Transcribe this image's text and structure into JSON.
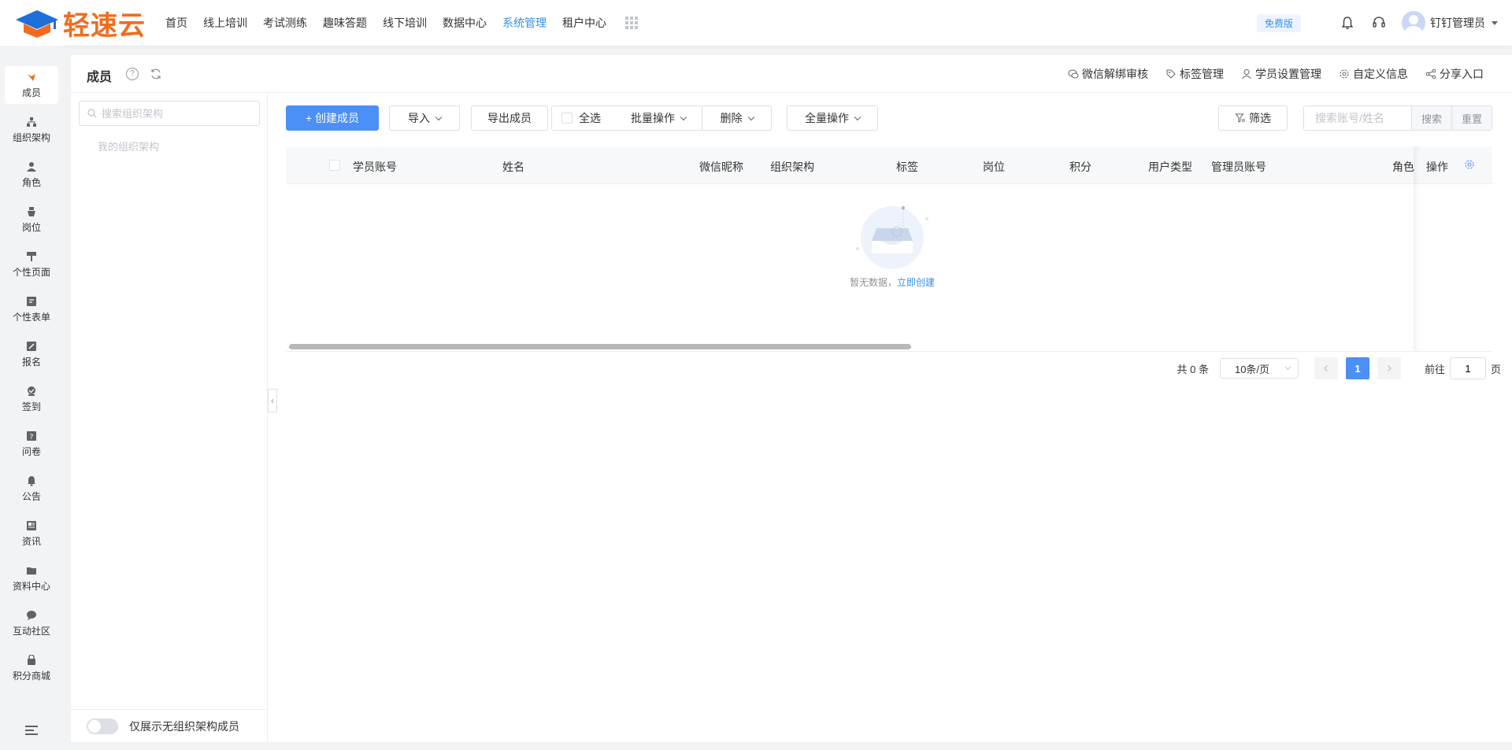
{
  "brand": {
    "name": "轻速云",
    "color": "#f26b1d"
  },
  "colors": {
    "primary": "#4b8ff7",
    "active_nav": "#3a8ee6"
  },
  "topnav": {
    "items": [
      {
        "label": "首页",
        "active": false
      },
      {
        "label": "线上培训",
        "active": false
      },
      {
        "label": "考试测练",
        "active": false
      },
      {
        "label": "趣味答题",
        "active": false
      },
      {
        "label": "线下培训",
        "active": false
      },
      {
        "label": "数据中心",
        "active": false
      },
      {
        "label": "系统管理",
        "active": true
      },
      {
        "label": "租户中心",
        "active": false
      }
    ],
    "apps_icon": "grid-icon"
  },
  "topbar_right": {
    "plan_badge": "免费版",
    "bell_icon": "bell-icon",
    "support_icon": "headset-icon",
    "user_name": "钉钉管理员"
  },
  "sidebar": {
    "items": [
      {
        "label": "成员",
        "icon": "member-icon",
        "active": true
      },
      {
        "label": "组织架构",
        "icon": "org-icon",
        "active": false
      },
      {
        "label": "角色",
        "icon": "role-icon",
        "active": false
      },
      {
        "label": "岗位",
        "icon": "post-icon",
        "active": false
      },
      {
        "label": "个性页面",
        "icon": "brush-icon",
        "active": false
      },
      {
        "label": "个性表单",
        "icon": "form-icon",
        "active": false
      },
      {
        "label": "报名",
        "icon": "signup-icon",
        "active": false
      },
      {
        "label": "签到",
        "icon": "checkin-icon",
        "active": false
      },
      {
        "label": "问卷",
        "icon": "survey-icon",
        "active": false
      },
      {
        "label": "公告",
        "icon": "notice-icon",
        "active": false
      },
      {
        "label": "资讯",
        "icon": "news-icon",
        "active": false
      },
      {
        "label": "资料中心",
        "icon": "folder-icon",
        "active": false
      },
      {
        "label": "互动社区",
        "icon": "chat-icon",
        "active": false
      },
      {
        "label": "积分商城",
        "icon": "shop-icon",
        "active": false
      }
    ]
  },
  "header": {
    "title": "成员",
    "help": "?",
    "links": [
      {
        "label": "微信解绑审核",
        "icon": "wechat-icon"
      },
      {
        "label": "标签管理",
        "icon": "tag-icon"
      },
      {
        "label": "学员设置管理",
        "icon": "user-icon"
      },
      {
        "label": "自定义信息",
        "icon": "gear-icon"
      },
      {
        "label": "分享入口",
        "icon": "share-icon"
      }
    ]
  },
  "org_panel": {
    "search_placeholder": "搜索组织架构",
    "empty_text": "我的组织架构",
    "footer_toggle_label": "仅展示无组织架构成员",
    "toggle_on": false
  },
  "toolbar": {
    "create": "+ 创建成员",
    "import": "导入",
    "export": "导出成员",
    "select_all": "全选",
    "batch": "批量操作",
    "delete": "删除",
    "all_ops": "全量操作",
    "filter": "筛选",
    "search_placeholder": "搜索账号/姓名",
    "search_btn": "搜索",
    "reset_btn": "重置"
  },
  "table": {
    "columns": [
      "学员账号",
      "姓名",
      "微信昵称",
      "组织架构",
      "标签",
      "岗位",
      "积分",
      "用户类型",
      "管理员账号",
      "角色",
      "操作"
    ],
    "rows": [],
    "empty_text": "暂无数据，",
    "empty_link": "立即创建"
  },
  "pagination": {
    "total_text": "共 0 条",
    "page_size": "10条/页",
    "current_page": "1",
    "goto_prefix": "前往",
    "goto_value": "1",
    "goto_suffix": "页"
  }
}
